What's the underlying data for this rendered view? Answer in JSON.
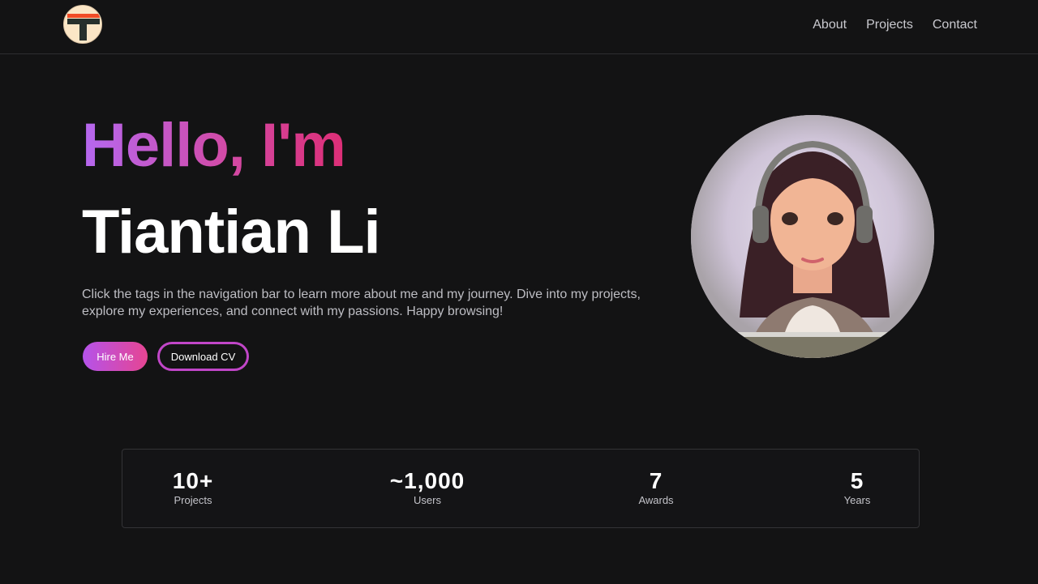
{
  "nav": {
    "logo_alt": "Tiantian Li logo",
    "links": [
      "About",
      "Projects",
      "Contact"
    ]
  },
  "hero": {
    "greeting": "Hello, I'm",
    "name": "Tiantian Li",
    "description": "Click the tags in the navigation bar to learn more about me and my journey. Dive into my projects, explore my experiences, and connect with my passions. Happy browsing!",
    "primary_button": "Hire Me",
    "secondary_button": "Download CV"
  },
  "stats": [
    {
      "value": "10+",
      "label": "Projects"
    },
    {
      "value": "~1,000",
      "label": "Users"
    },
    {
      "value": "7",
      "label": "Awards"
    },
    {
      "value": "5",
      "label": "Years"
    }
  ],
  "colors": {
    "background": "#131314",
    "accent_start": "#b553ea",
    "accent_end": "#e64592"
  }
}
